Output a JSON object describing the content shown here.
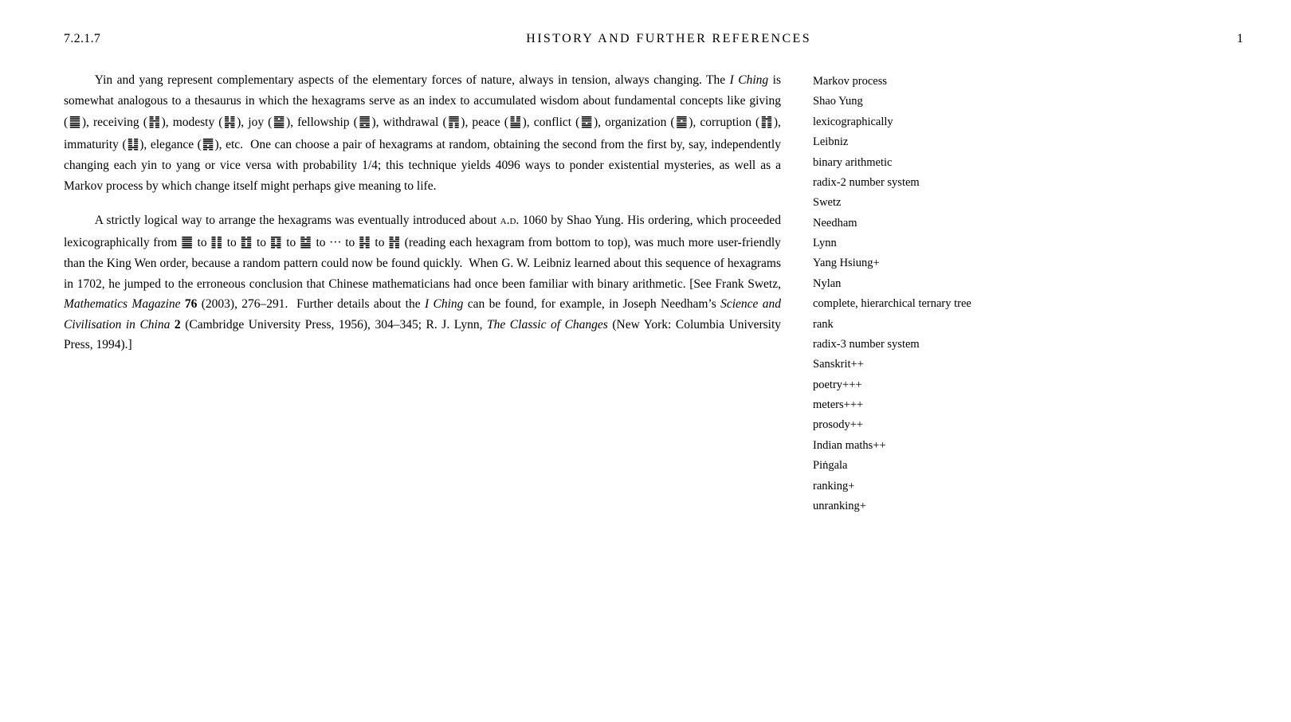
{
  "header": {
    "left": "7.2.1.7",
    "center": "HISTORY AND FURTHER REFERENCES",
    "right": "1"
  },
  "main": {
    "paragraph1": {
      "parts": [
        "Yin and yang represent complementary aspects of the elementary forces of nature, always in tension, always changing. The ",
        "I Ching",
        " is somewhat analogous to a thesaurus in which the hexagrams serve as an index to accumulated wisdom about fundamental concepts like giving (",
        "☰",
        "), receiving (",
        "☷",
        "), modesty (",
        "☶",
        "), joy (",
        "☱",
        "), fellowship (",
        "☲",
        "), withdrawal (",
        "☳",
        "), peace (",
        "☴",
        "), conflict (",
        "☵",
        "), organization (",
        "☯",
        "), corruption (",
        "☮",
        "), immaturity (",
        "☬",
        "), elegance (",
        "☫",
        "), etc.  One can choose a pair of hexagrams at random, obtaining the second from the first by, say, independently changing each yin to yang or vice versa with probability 1/4; this technique yields 4096 ways to ponder existential mysteries, as well as a Markov process by which change itself might perhaps give meaning to life."
      ]
    },
    "paragraph2": {
      "intro": "A strictly logical way to arrange the hexagrams was eventually introduced about A.D. 1060 by Shao Yung. His ordering, which proceeded lexicographically from ",
      "sequence": "≡≡ to ≡☷ to ≡☶ to ≡☱ to ≡☰ to ··· to ☷≡ to ☷☷",
      "rest": " (reading each hexagram from bottom to top), was much more user-friendly than the King Wen order, because a random pattern could now be found quickly.  When G. W. Leibniz learned about this sequence of hexagrams in 1702, he jumped to the erroneous conclusion that Chinese mathematicians had once been familiar with binary arithmetic. [See Frank Swetz, ",
      "mag": "Mathematics Magazine",
      "bold76": "76",
      "after76": " (2003), 276–291.  Further details about the ",
      "iching": "I Ching",
      "found": " can be found, for example, in Joseph Needham’s ",
      "sciit": "Science and Civilisation in China",
      "bold2": "2",
      "close": " (Cambridge University Press, 1956), 304–345; R. J. Lynn, ",
      "classic": "The Classic of Changes",
      "final": " (New York: Columbia University Press, 1994).]"
    }
  },
  "sidebar": {
    "items": [
      "Markov process",
      "Shao Yung",
      "lexicographically",
      "Leibniz",
      "binary arithmetic",
      "radix-2 number system",
      "Swetz",
      "Needham",
      "Lynn",
      "Yang Hsiung+",
      "Nylan",
      "complete, hierarchical ternary tree",
      "rank",
      "radix-3 number system",
      "Sanskrit++",
      "poetry+++",
      "meters+++",
      "prosody++",
      "Indian maths++",
      "Piṅgala",
      "ranking+",
      "unranking+"
    ]
  }
}
